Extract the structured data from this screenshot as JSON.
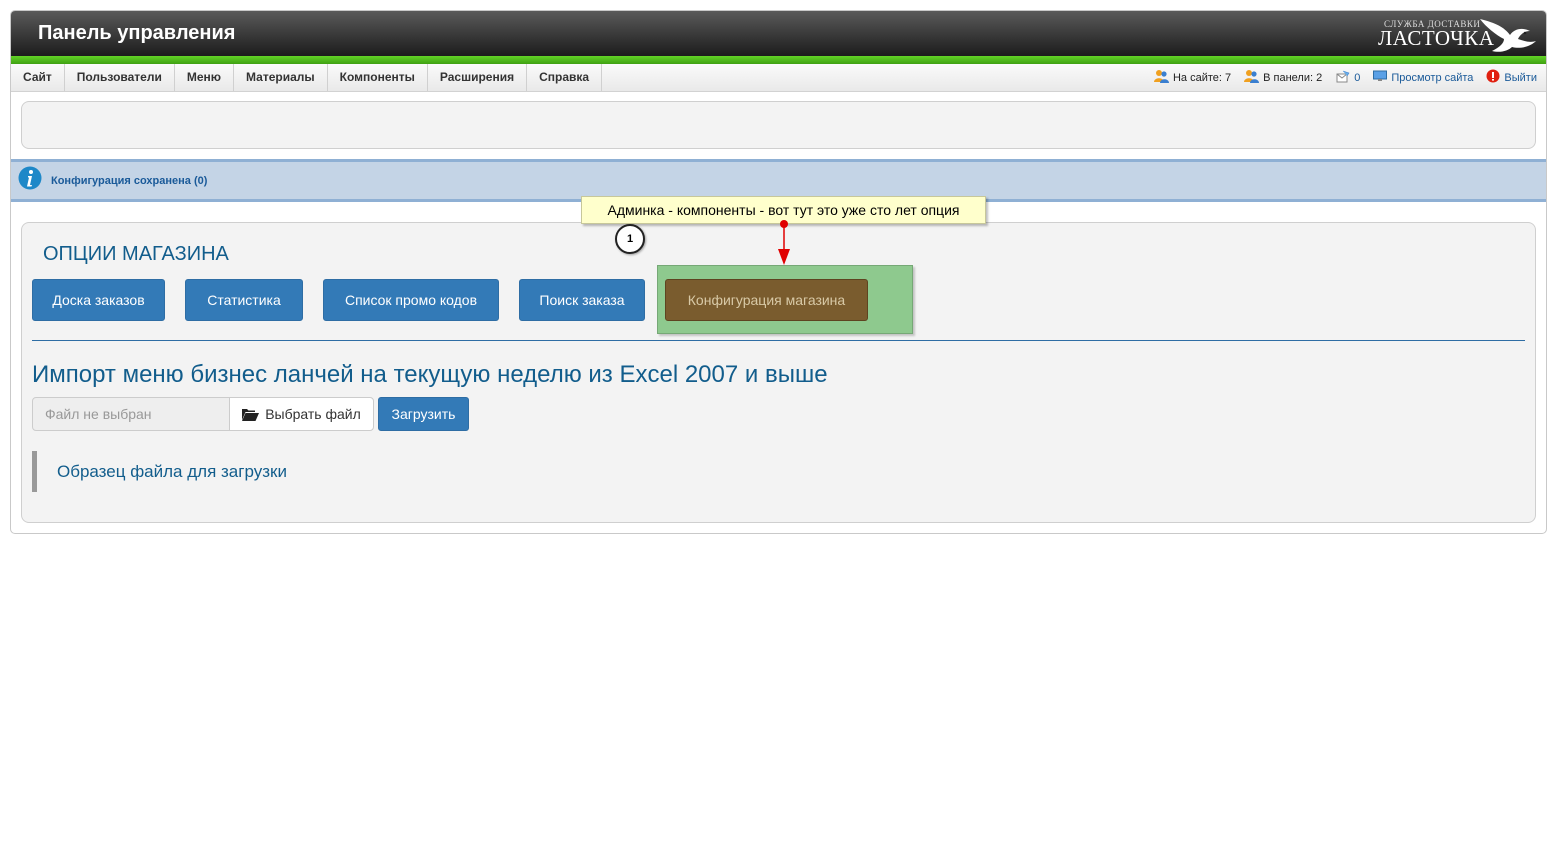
{
  "header": {
    "title": "Панель управления",
    "logo_tagline": "СЛУЖБА ДОСТАВКИ",
    "logo_name": "ЛАСТОЧКА"
  },
  "menu": {
    "items": [
      {
        "label": "Сайт"
      },
      {
        "label": "Пользователи"
      },
      {
        "label": "Меню"
      },
      {
        "label": "Материалы"
      },
      {
        "label": "Компоненты"
      },
      {
        "label": "Расширения"
      },
      {
        "label": "Справка"
      }
    ]
  },
  "status": {
    "on_site": "На сайте: 7",
    "in_panel": "В панели: 2",
    "messages": "0",
    "view_site": "Просмотр сайта",
    "logout": "Выйти"
  },
  "message": {
    "text": "Конфигурация сохранена (0)"
  },
  "shop": {
    "title": "ОПЦИИ МАГАЗИНА",
    "buttons": [
      {
        "label": "Доска заказов"
      },
      {
        "label": "Статистика"
      },
      {
        "label": "Список промо кодов"
      },
      {
        "label": "Поиск заказа"
      },
      {
        "label": "Конфигурация магазина"
      }
    ]
  },
  "import": {
    "title": "Импорт меню бизнес ланчей на текущую неделю из Excel 2007 и выше",
    "file_placeholder": "Файл не выбран",
    "choose_label": "Выбрать файл",
    "upload_label": "Загрузить",
    "sample_link": "Образец файла для загрузки"
  },
  "annotation": {
    "callout_text": "Админка - компоненты - вот тут это уже сто лет опция",
    "step_number": "1"
  },
  "colors": {
    "header_dark": "#1c1c1c",
    "green_bar": "#4fba1a",
    "primary_button": "#337ab7",
    "highlight_green": "#8ec98e",
    "highlighted_button": "#7a5c2e",
    "link_blue": "#125d8c",
    "message_bg": "#c4d4e6",
    "callout_bg": "#ffffcc",
    "arrow_red": "#e00000"
  },
  "icons": {
    "users": "users-icon",
    "admins": "admins-icon",
    "messages": "messages-icon",
    "view_site": "monitor-icon",
    "logout": "power-icon",
    "info": "info-icon",
    "folder": "folder-open-icon",
    "logo": "swallow-icon"
  }
}
